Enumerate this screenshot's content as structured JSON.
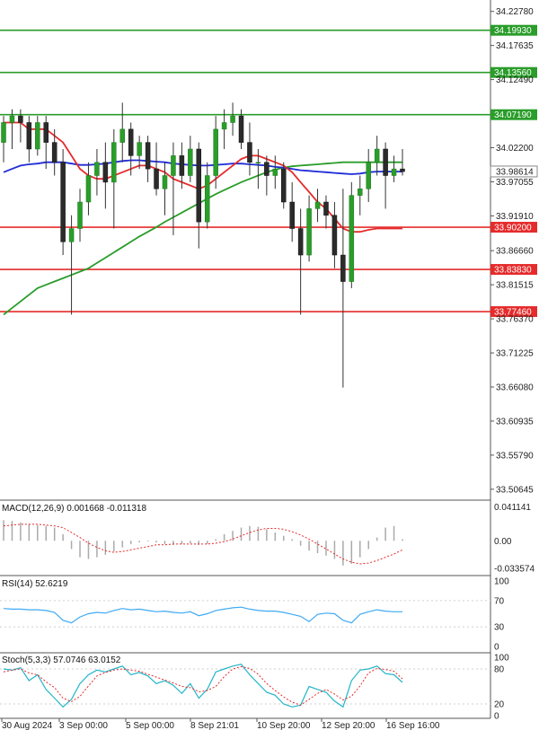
{
  "chart_data": {
    "type": "candlestick",
    "price_axis_ticks": [
      "34.22780",
      "34.17635",
      "34.12490",
      "34.02200",
      "33.97055",
      "33.91910",
      "33.86660",
      "33.81515",
      "33.76370",
      "33.71225",
      "33.66080",
      "33.60935",
      "33.55790",
      "33.50645"
    ],
    "price_range": [
      33.49,
      34.245
    ],
    "current_price": "33.98614",
    "levels": [
      {
        "label": "34.19930",
        "value": 34.1993,
        "color": "#2a9d2a"
      },
      {
        "label": "34.13560",
        "value": 34.1356,
        "color": "#2a9d2a"
      },
      {
        "label": "34.07190",
        "value": 34.0719,
        "color": "#2a9d2a"
      },
      {
        "label": "33.90200",
        "value": 33.902,
        "color": "#e52b2b"
      },
      {
        "label": "33.83830",
        "value": 33.8383,
        "color": "#e52b2b"
      },
      {
        "label": "33.77460",
        "value": 33.7746,
        "color": "#e52b2b"
      }
    ],
    "x_labels": [
      "30 Aug 2024",
      "3 Sep 00:00",
      "5 Sep 00:00",
      "8 Sep 21:01",
      "10 Sep 20:00",
      "12 Sep 20:00",
      "16 Sep 16:00"
    ],
    "candles": [
      {
        "o": 34.03,
        "h": 34.07,
        "l": 34.0,
        "c": 34.06
      },
      {
        "o": 34.06,
        "h": 34.08,
        "l": 34.02,
        "c": 34.07
      },
      {
        "o": 34.07,
        "h": 34.08,
        "l": 34.03,
        "c": 34.06
      },
      {
        "o": 34.06,
        "h": 34.07,
        "l": 34.0,
        "c": 34.02
      },
      {
        "o": 34.02,
        "h": 34.07,
        "l": 34.01,
        "c": 34.06
      },
      {
        "o": 34.06,
        "h": 34.07,
        "l": 33.99,
        "c": 34.03
      },
      {
        "o": 34.03,
        "h": 34.05,
        "l": 33.98,
        "c": 34.0
      },
      {
        "o": 34.0,
        "h": 34.02,
        "l": 33.86,
        "c": 33.88
      },
      {
        "o": 33.88,
        "h": 33.92,
        "l": 33.77,
        "c": 33.9
      },
      {
        "o": 33.9,
        "h": 33.96,
        "l": 33.88,
        "c": 33.94
      },
      {
        "o": 33.94,
        "h": 34.0,
        "l": 33.92,
        "c": 33.98
      },
      {
        "o": 33.98,
        "h": 34.02,
        "l": 33.95,
        "c": 34.0
      },
      {
        "o": 34.0,
        "h": 34.03,
        "l": 33.93,
        "c": 33.97
      },
      {
        "o": 33.97,
        "h": 34.05,
        "l": 33.9,
        "c": 34.03
      },
      {
        "o": 34.03,
        "h": 34.09,
        "l": 34.0,
        "c": 34.05
      },
      {
        "o": 34.05,
        "h": 34.06,
        "l": 33.98,
        "c": 34.01
      },
      {
        "o": 34.01,
        "h": 34.04,
        "l": 33.99,
        "c": 34.03
      },
      {
        "o": 34.03,
        "h": 34.04,
        "l": 33.97,
        "c": 33.99
      },
      {
        "o": 33.99,
        "h": 34.03,
        "l": 33.95,
        "c": 33.96
      },
      {
        "o": 33.96,
        "h": 34.0,
        "l": 33.92,
        "c": 33.98
      },
      {
        "o": 33.98,
        "h": 34.03,
        "l": 33.89,
        "c": 34.01
      },
      {
        "o": 34.01,
        "h": 34.03,
        "l": 33.96,
        "c": 33.98
      },
      {
        "o": 33.98,
        "h": 34.04,
        "l": 33.97,
        "c": 34.02
      },
      {
        "o": 34.02,
        "h": 34.03,
        "l": 33.87,
        "c": 33.91
      },
      {
        "o": 33.91,
        "h": 34.0,
        "l": 33.9,
        "c": 33.98
      },
      {
        "o": 33.98,
        "h": 34.07,
        "l": 33.96,
        "c": 34.05
      },
      {
        "o": 34.05,
        "h": 34.08,
        "l": 34.02,
        "c": 34.06
      },
      {
        "o": 34.06,
        "h": 34.09,
        "l": 34.04,
        "c": 34.07
      },
      {
        "o": 34.07,
        "h": 34.08,
        "l": 34.02,
        "c": 34.03
      },
      {
        "o": 34.03,
        "h": 34.06,
        "l": 33.98,
        "c": 34.0
      },
      {
        "o": 34.0,
        "h": 34.02,
        "l": 33.96,
        "c": 34.0
      },
      {
        "o": 34.0,
        "h": 34.01,
        "l": 33.95,
        "c": 33.98
      },
      {
        "o": 33.98,
        "h": 34.01,
        "l": 33.96,
        "c": 33.99
      },
      {
        "o": 33.99,
        "h": 34.0,
        "l": 33.93,
        "c": 33.94
      },
      {
        "o": 33.94,
        "h": 33.97,
        "l": 33.88,
        "c": 33.9
      },
      {
        "o": 33.9,
        "h": 33.93,
        "l": 33.77,
        "c": 33.86
      },
      {
        "o": 33.86,
        "h": 33.95,
        "l": 33.85,
        "c": 33.93
      },
      {
        "o": 33.93,
        "h": 33.96,
        "l": 33.91,
        "c": 33.94
      },
      {
        "o": 33.94,
        "h": 33.95,
        "l": 33.9,
        "c": 33.92
      },
      {
        "o": 33.92,
        "h": 33.94,
        "l": 33.84,
        "c": 33.86
      },
      {
        "o": 33.86,
        "h": 33.96,
        "l": 33.66,
        "c": 33.82
      },
      {
        "o": 33.82,
        "h": 33.97,
        "l": 33.81,
        "c": 33.95
      },
      {
        "o": 33.95,
        "h": 33.98,
        "l": 33.92,
        "c": 33.96
      },
      {
        "o": 33.96,
        "h": 34.02,
        "l": 33.94,
        "c": 34.0
      },
      {
        "o": 34.0,
        "h": 34.04,
        "l": 33.98,
        "c": 34.02
      },
      {
        "o": 34.02,
        "h": 34.03,
        "l": 33.93,
        "c": 33.98
      },
      {
        "o": 33.98,
        "h": 34.01,
        "l": 33.97,
        "c": 33.99
      },
      {
        "o": 33.99,
        "h": 34.02,
        "l": 33.98,
        "c": 33.986
      }
    ],
    "ma_fast": [
      34.06,
      34.06,
      34.06,
      34.05,
      34.05,
      34.05,
      34.04,
      34.03,
      34.01,
      33.99,
      33.98,
      33.975,
      33.975,
      33.98,
      33.985,
      33.99,
      33.995,
      33.995,
      33.99,
      33.985,
      33.975,
      33.97,
      33.965,
      33.96,
      33.965,
      33.975,
      33.985,
      33.995,
      34.005,
      34.01,
      34.01,
      34.005,
      34.0,
      33.995,
      33.985,
      33.97,
      33.955,
      33.94,
      33.93,
      33.915,
      33.9,
      33.895,
      33.895,
      33.898,
      33.9,
      33.9,
      33.9,
      33.9
    ],
    "ma_mid": [
      33.985,
      33.99,
      33.995,
      33.997,
      33.998,
      34.0,
      34.0,
      34.0,
      33.998,
      33.996,
      33.996,
      33.997,
      33.998,
      34.0,
      34.002,
      34.003,
      34.003,
      34.002,
      34.001,
      34.0,
      33.998,
      33.997,
      33.996,
      33.995,
      33.995,
      33.996,
      33.997,
      33.998,
      33.998,
      33.997,
      33.996,
      33.995,
      33.993,
      33.992,
      33.99,
      33.988,
      33.987,
      33.986,
      33.985,
      33.984,
      33.983,
      33.982,
      33.983,
      33.985,
      33.986,
      33.986,
      33.986,
      33.986
    ],
    "ma_slow": [
      33.77,
      33.78,
      33.79,
      33.8,
      33.81,
      33.815,
      33.82,
      33.825,
      33.83,
      33.835,
      33.84,
      33.848,
      33.856,
      33.864,
      33.872,
      33.88,
      33.888,
      33.895,
      33.902,
      33.91,
      33.917,
      33.924,
      33.931,
      33.938,
      33.945,
      33.952,
      33.958,
      33.964,
      33.97,
      33.975,
      33.98,
      33.985,
      33.989,
      33.992,
      33.994,
      33.995,
      33.996,
      33.997,
      33.998,
      33.999,
      34.0,
      34.0,
      34.0,
      34.0,
      34.0,
      34.0,
      34.0,
      34.0
    ],
    "macd": {
      "label": "MACD(12,26,9) 0.001668 -0.011318",
      "ticks": [
        "0.041141",
        "0.00",
        "-0.033574"
      ],
      "range": [
        -0.04,
        0.046
      ],
      "hist": [
        0.025,
        0.024,
        0.022,
        0.02,
        0.019,
        0.018,
        0.016,
        0.008,
        -0.01,
        -0.02,
        -0.022,
        -0.02,
        -0.017,
        -0.013,
        -0.008,
        -0.004,
        -0.002,
        -0.001,
        -0.002,
        -0.004,
        -0.005,
        -0.004,
        -0.003,
        -0.005,
        -0.004,
        0.002,
        0.008,
        0.012,
        0.016,
        0.018,
        0.017,
        0.014,
        0.01,
        0.006,
        0.002,
        -0.006,
        -0.012,
        -0.015,
        -0.018,
        -0.022,
        -0.03,
        -0.028,
        -0.02,
        -0.01,
        0.004,
        0.016,
        0.018,
        0.002
      ],
      "signal": [
        0.018,
        0.019,
        0.02,
        0.02,
        0.02,
        0.019,
        0.018,
        0.016,
        0.01,
        0.004,
        -0.003,
        -0.008,
        -0.012,
        -0.014,
        -0.013,
        -0.011,
        -0.009,
        -0.007,
        -0.005,
        -0.005,
        -0.004,
        -0.004,
        -0.004,
        -0.004,
        -0.004,
        -0.003,
        -0.001,
        0.002,
        0.006,
        0.01,
        0.013,
        0.015,
        0.015,
        0.014,
        0.011,
        0.007,
        0.002,
        -0.004,
        -0.01,
        -0.016,
        -0.022,
        -0.026,
        -0.028,
        -0.027,
        -0.024,
        -0.02,
        -0.016,
        -0.011
      ]
    },
    "rsi": {
      "label": "RSI(14) 52.6219",
      "ticks": [
        "100",
        "70",
        "30",
        "0"
      ],
      "values": [
        58,
        57,
        57,
        56,
        56,
        55,
        52,
        40,
        36,
        45,
        50,
        52,
        51,
        55,
        58,
        56,
        57,
        55,
        53,
        54,
        52,
        51,
        53,
        47,
        50,
        55,
        57,
        59,
        60,
        57,
        55,
        54,
        54,
        52,
        49,
        46,
        38,
        49,
        51,
        50,
        40,
        36,
        49,
        53,
        56,
        54,
        53,
        53
      ]
    },
    "stoch": {
      "label": "Stoch(5,3,3) 57.0746 63.0152",
      "ticks": [
        "100",
        "80",
        "20",
        "0"
      ],
      "k": [
        80,
        78,
        82,
        60,
        70,
        45,
        30,
        15,
        28,
        55,
        70,
        78,
        75,
        80,
        85,
        70,
        74,
        68,
        55,
        60,
        52,
        38,
        55,
        30,
        45,
        75,
        80,
        85,
        88,
        70,
        55,
        40,
        35,
        20,
        15,
        18,
        50,
        45,
        40,
        25,
        15,
        60,
        78,
        80,
        85,
        72,
        70,
        57
      ],
      "d": [
        75,
        78,
        80,
        73,
        70,
        58,
        48,
        30,
        24,
        33,
        51,
        68,
        74,
        78,
        80,
        78,
        76,
        71,
        66,
        61,
        56,
        50,
        48,
        41,
        43,
        50,
        67,
        80,
        84,
        81,
        71,
        55,
        43,
        32,
        23,
        18,
        28,
        38,
        45,
        37,
        27,
        33,
        51,
        73,
        81,
        79,
        76,
        63
      ]
    }
  }
}
